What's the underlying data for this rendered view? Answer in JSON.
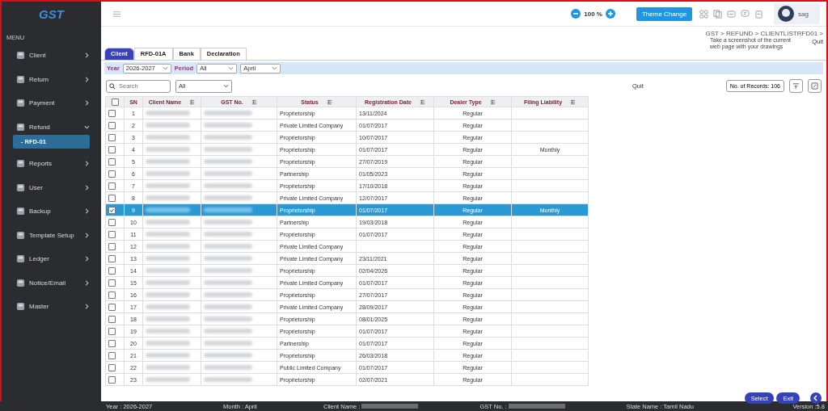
{
  "logo": "GST",
  "sidebar": {
    "heading": "MENU",
    "items": [
      {
        "label": "Client",
        "expanded": false
      },
      {
        "label": "Return",
        "expanded": false
      },
      {
        "label": "Payment",
        "expanded": false
      },
      {
        "label": "Refund",
        "expanded": true,
        "children": [
          {
            "label": "- RFD-01",
            "selected": true
          }
        ]
      },
      {
        "label": "Reports",
        "expanded": false
      },
      {
        "label": "User",
        "expanded": false
      },
      {
        "label": "Backup",
        "expanded": false
      },
      {
        "label": "Template Setup",
        "expanded": false
      },
      {
        "label": "Ledger",
        "expanded": false
      },
      {
        "label": "Notice/Email",
        "expanded": false
      },
      {
        "label": "Master",
        "expanded": false
      }
    ]
  },
  "header": {
    "zoom": "100 %",
    "theme_button": "Theme Change",
    "user": "sag"
  },
  "breadcrumb": "GST > REFUND > CLIENTLISTRFD01 >",
  "quit_top": "Quit",
  "tooltip": "Take a screenshot of the current web page with your drawings",
  "tabs": [
    {
      "label": "Client",
      "selected": true
    },
    {
      "label": "RFD-01A",
      "selected": false
    },
    {
      "label": "Bank",
      "selected": false
    },
    {
      "label": "Declaration",
      "selected": false
    }
  ],
  "filters": {
    "year_label": "Year",
    "year": "2026-2027",
    "period_label": "Period",
    "period": "All",
    "month": "April"
  },
  "search": {
    "placeholder": "Search",
    "filter": "All"
  },
  "quit_mid": "Quit",
  "records": "No. of Records: 106",
  "table": {
    "select_all_checked": false,
    "columns": [
      "SN",
      "Client Name",
      "GST No.",
      "Status",
      "Registration Date",
      "Dealer Type",
      "Filing Liability"
    ],
    "rows": [
      {
        "sn": "1",
        "status": "Proprietorship",
        "date": "13/11/2024",
        "dealer": "Regular",
        "checked": false,
        "selected": false
      },
      {
        "sn": "2",
        "status": "Private Limited Company",
        "date": "01/07/2017",
        "dealer": "Regular",
        "checked": false,
        "selected": false
      },
      {
        "sn": "3",
        "status": "Proprietorship",
        "date": "10/07/2017",
        "dealer": "Regular",
        "checked": false,
        "selected": false
      },
      {
        "sn": "4",
        "status": "Proprietorship",
        "date": "01/07/2017",
        "dealer": "Regular",
        "liability": "Monthly",
        "checked": false,
        "selected": false
      },
      {
        "sn": "5",
        "status": "Proprietorship",
        "date": "27/07/2019",
        "dealer": "Regular",
        "checked": false,
        "selected": false
      },
      {
        "sn": "6",
        "status": "Partnership",
        "date": "01/05/2023",
        "dealer": "Regular",
        "checked": false,
        "selected": false
      },
      {
        "sn": "7",
        "status": "Proprietorship",
        "date": "17/10/2018",
        "dealer": "Regular",
        "checked": false,
        "selected": false
      },
      {
        "sn": "8",
        "status": "Private Limited Company",
        "date": "12/07/2017",
        "dealer": "Regular",
        "checked": false,
        "selected": false
      },
      {
        "sn": "9",
        "status": "Proprietorship",
        "date": "01/07/2017",
        "dealer": "Regular",
        "liability": "Monthly",
        "checked": true,
        "selected": true
      },
      {
        "sn": "10",
        "status": "Partnership",
        "date": "19/03/2018",
        "dealer": "Regular",
        "checked": false,
        "selected": false
      },
      {
        "sn": "11",
        "status": "Proprietorship",
        "date": "01/07/2017",
        "dealer": "Regular",
        "checked": false,
        "selected": false
      },
      {
        "sn": "12",
        "status": "Private Limited Company",
        "dealer": "Regular",
        "checked": false,
        "selected": false
      },
      {
        "sn": "13",
        "status": "Private Limited Company",
        "date": "23/11/2021",
        "dealer": "Regular",
        "checked": false,
        "selected": false
      },
      {
        "sn": "14",
        "status": "Proprietorship",
        "date": "02/04/2026",
        "dealer": "Regular",
        "checked": false,
        "selected": false
      },
      {
        "sn": "15",
        "status": "Private Limited Company",
        "date": "01/07/2017",
        "dealer": "Regular",
        "checked": false,
        "selected": false
      },
      {
        "sn": "16",
        "status": "Proprietorship",
        "date": "27/07/2017",
        "dealer": "Regular",
        "checked": false,
        "selected": false
      },
      {
        "sn": "17",
        "status": "Private Limited Company",
        "date": "28/09/2017",
        "dealer": "Regular",
        "checked": false,
        "selected": false
      },
      {
        "sn": "18",
        "status": "Proprietorship",
        "date": "08/01/2025",
        "dealer": "Regular",
        "checked": false,
        "selected": false
      },
      {
        "sn": "19",
        "status": "Proprietorship",
        "date": "01/07/2017",
        "dealer": "Regular",
        "checked": false,
        "selected": false
      },
      {
        "sn": "20",
        "status": "Partnership",
        "date": "01/07/2017",
        "dealer": "Regular",
        "checked": false,
        "selected": false
      },
      {
        "sn": "21",
        "status": "Proprietorship",
        "date": "26/03/2018",
        "dealer": "Regular",
        "checked": false,
        "selected": false
      },
      {
        "sn": "22",
        "status": "Public Limited Company",
        "date": "01/07/2017",
        "dealer": "Regular",
        "checked": false,
        "selected": false
      },
      {
        "sn": "23",
        "status": "Proprietorship",
        "date": "02/07/2021",
        "dealer": "Regular",
        "checked": false,
        "selected": false
      }
    ]
  },
  "buttons": [
    "Select",
    "Exit"
  ],
  "status_bar": {
    "year": "Year : 2026-2027",
    "month": "Month : April",
    "client": "Client Name :",
    "gst": "GST No. :",
    "state": "State Name : Tamil Nadu",
    "version": "Version :5.8"
  }
}
